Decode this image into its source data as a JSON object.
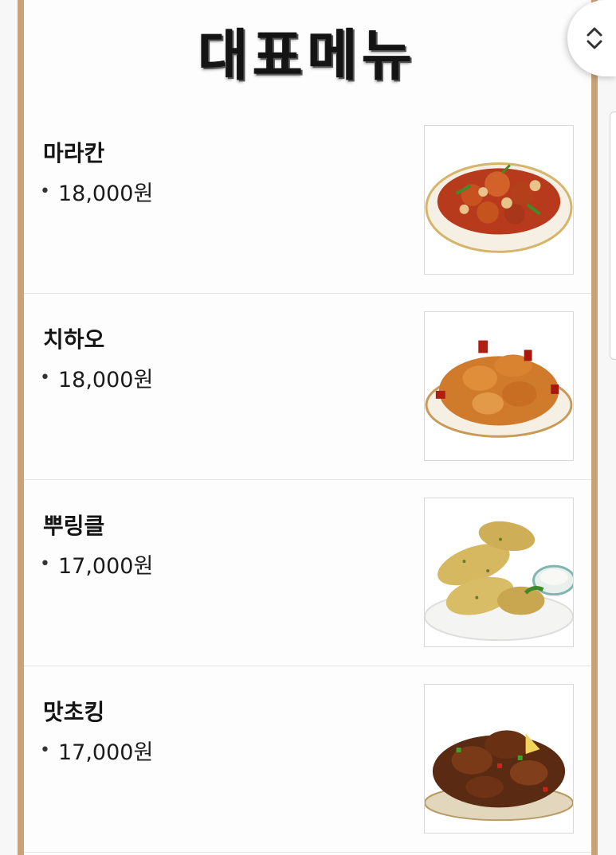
{
  "header": {
    "title": "대표메뉴"
  },
  "colors": {
    "border_accent": "#c9a27a"
  },
  "scroll_button": {
    "icon": "unfold-more-icon"
  },
  "menu": {
    "items": [
      {
        "name": "마라칸",
        "bullet": "•",
        "price": "18,000원",
        "image": "mala-chicken-photo"
      },
      {
        "name": "치하오",
        "bullet": "•",
        "price": "18,000원",
        "image": "spicy-chicken-photo"
      },
      {
        "name": "뿌링클",
        "bullet": "•",
        "price": "17,000원",
        "image": "seasoned-powder-chicken-photo"
      },
      {
        "name": "맛초킹",
        "bullet": "•",
        "price": "17,000원",
        "image": "soy-garlic-chicken-photo"
      }
    ]
  }
}
